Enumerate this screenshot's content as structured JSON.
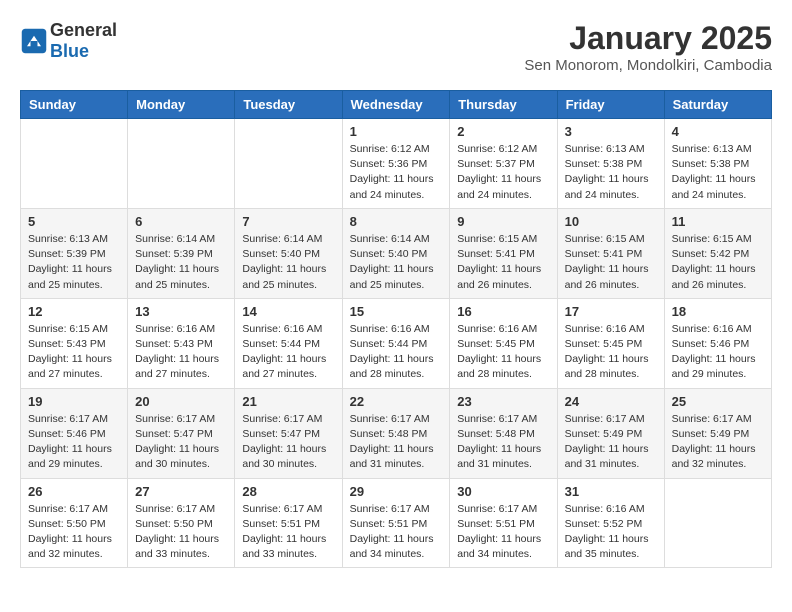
{
  "header": {
    "logo_general": "General",
    "logo_blue": "Blue",
    "month_year": "January 2025",
    "location": "Sen Monorom, Mondolkiri, Cambodia"
  },
  "weekdays": [
    "Sunday",
    "Monday",
    "Tuesday",
    "Wednesday",
    "Thursday",
    "Friday",
    "Saturday"
  ],
  "weeks": [
    [
      {
        "day": "",
        "info": ""
      },
      {
        "day": "",
        "info": ""
      },
      {
        "day": "",
        "info": ""
      },
      {
        "day": "1",
        "info": "Sunrise: 6:12 AM\nSunset: 5:36 PM\nDaylight: 11 hours\nand 24 minutes."
      },
      {
        "day": "2",
        "info": "Sunrise: 6:12 AM\nSunset: 5:37 PM\nDaylight: 11 hours\nand 24 minutes."
      },
      {
        "day": "3",
        "info": "Sunrise: 6:13 AM\nSunset: 5:38 PM\nDaylight: 11 hours\nand 24 minutes."
      },
      {
        "day": "4",
        "info": "Sunrise: 6:13 AM\nSunset: 5:38 PM\nDaylight: 11 hours\nand 24 minutes."
      }
    ],
    [
      {
        "day": "5",
        "info": "Sunrise: 6:13 AM\nSunset: 5:39 PM\nDaylight: 11 hours\nand 25 minutes."
      },
      {
        "day": "6",
        "info": "Sunrise: 6:14 AM\nSunset: 5:39 PM\nDaylight: 11 hours\nand 25 minutes."
      },
      {
        "day": "7",
        "info": "Sunrise: 6:14 AM\nSunset: 5:40 PM\nDaylight: 11 hours\nand 25 minutes."
      },
      {
        "day": "8",
        "info": "Sunrise: 6:14 AM\nSunset: 5:40 PM\nDaylight: 11 hours\nand 25 minutes."
      },
      {
        "day": "9",
        "info": "Sunrise: 6:15 AM\nSunset: 5:41 PM\nDaylight: 11 hours\nand 26 minutes."
      },
      {
        "day": "10",
        "info": "Sunrise: 6:15 AM\nSunset: 5:41 PM\nDaylight: 11 hours\nand 26 minutes."
      },
      {
        "day": "11",
        "info": "Sunrise: 6:15 AM\nSunset: 5:42 PM\nDaylight: 11 hours\nand 26 minutes."
      }
    ],
    [
      {
        "day": "12",
        "info": "Sunrise: 6:15 AM\nSunset: 5:43 PM\nDaylight: 11 hours\nand 27 minutes."
      },
      {
        "day": "13",
        "info": "Sunrise: 6:16 AM\nSunset: 5:43 PM\nDaylight: 11 hours\nand 27 minutes."
      },
      {
        "day": "14",
        "info": "Sunrise: 6:16 AM\nSunset: 5:44 PM\nDaylight: 11 hours\nand 27 minutes."
      },
      {
        "day": "15",
        "info": "Sunrise: 6:16 AM\nSunset: 5:44 PM\nDaylight: 11 hours\nand 28 minutes."
      },
      {
        "day": "16",
        "info": "Sunrise: 6:16 AM\nSunset: 5:45 PM\nDaylight: 11 hours\nand 28 minutes."
      },
      {
        "day": "17",
        "info": "Sunrise: 6:16 AM\nSunset: 5:45 PM\nDaylight: 11 hours\nand 28 minutes."
      },
      {
        "day": "18",
        "info": "Sunrise: 6:16 AM\nSunset: 5:46 PM\nDaylight: 11 hours\nand 29 minutes."
      }
    ],
    [
      {
        "day": "19",
        "info": "Sunrise: 6:17 AM\nSunset: 5:46 PM\nDaylight: 11 hours\nand 29 minutes."
      },
      {
        "day": "20",
        "info": "Sunrise: 6:17 AM\nSunset: 5:47 PM\nDaylight: 11 hours\nand 30 minutes."
      },
      {
        "day": "21",
        "info": "Sunrise: 6:17 AM\nSunset: 5:47 PM\nDaylight: 11 hours\nand 30 minutes."
      },
      {
        "day": "22",
        "info": "Sunrise: 6:17 AM\nSunset: 5:48 PM\nDaylight: 11 hours\nand 31 minutes."
      },
      {
        "day": "23",
        "info": "Sunrise: 6:17 AM\nSunset: 5:48 PM\nDaylight: 11 hours\nand 31 minutes."
      },
      {
        "day": "24",
        "info": "Sunrise: 6:17 AM\nSunset: 5:49 PM\nDaylight: 11 hours\nand 31 minutes."
      },
      {
        "day": "25",
        "info": "Sunrise: 6:17 AM\nSunset: 5:49 PM\nDaylight: 11 hours\nand 32 minutes."
      }
    ],
    [
      {
        "day": "26",
        "info": "Sunrise: 6:17 AM\nSunset: 5:50 PM\nDaylight: 11 hours\nand 32 minutes."
      },
      {
        "day": "27",
        "info": "Sunrise: 6:17 AM\nSunset: 5:50 PM\nDaylight: 11 hours\nand 33 minutes."
      },
      {
        "day": "28",
        "info": "Sunrise: 6:17 AM\nSunset: 5:51 PM\nDaylight: 11 hours\nand 33 minutes."
      },
      {
        "day": "29",
        "info": "Sunrise: 6:17 AM\nSunset: 5:51 PM\nDaylight: 11 hours\nand 34 minutes."
      },
      {
        "day": "30",
        "info": "Sunrise: 6:17 AM\nSunset: 5:51 PM\nDaylight: 11 hours\nand 34 minutes."
      },
      {
        "day": "31",
        "info": "Sunrise: 6:16 AM\nSunset: 5:52 PM\nDaylight: 11 hours\nand 35 minutes."
      },
      {
        "day": "",
        "info": ""
      }
    ]
  ]
}
